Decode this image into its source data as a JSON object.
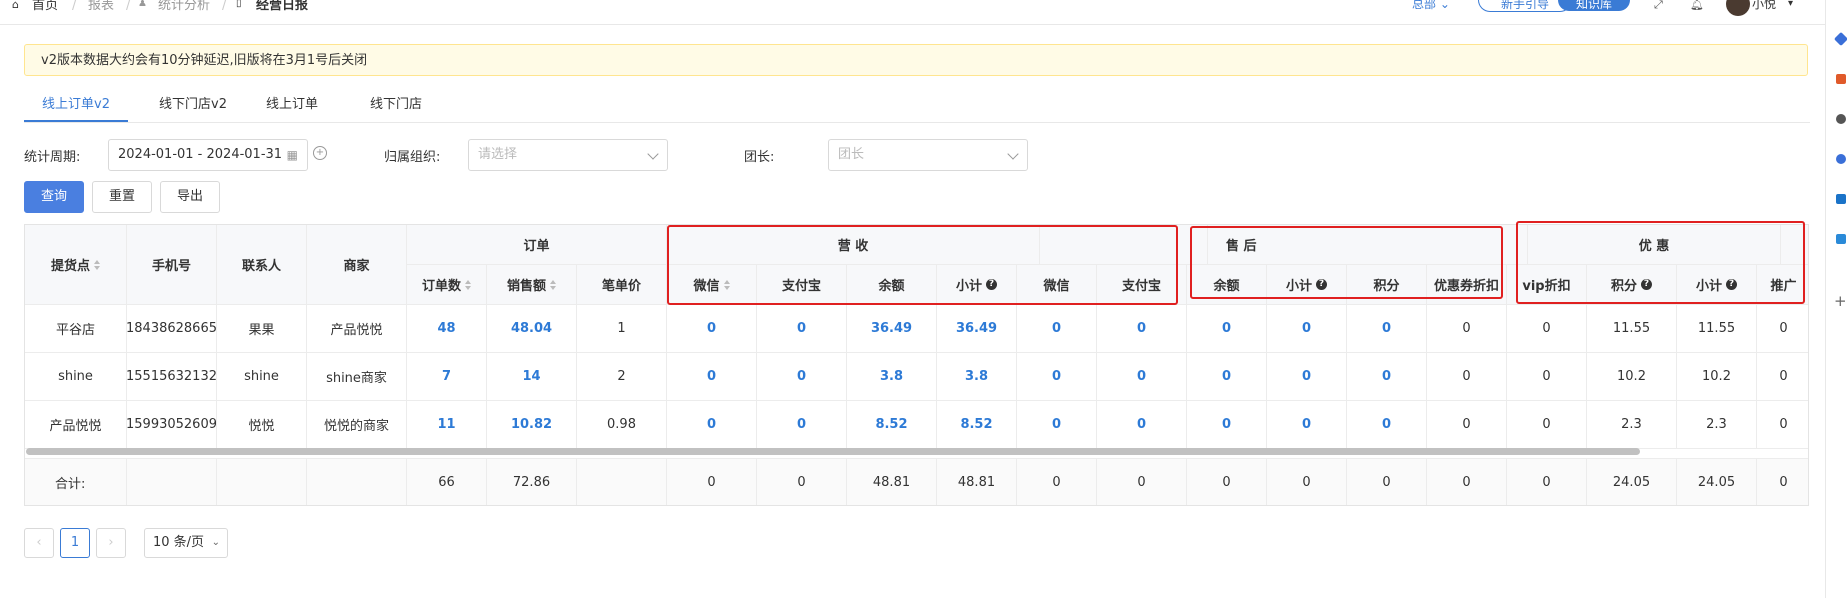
{
  "breadcrumb": [
    "首页",
    "报表",
    "统计分析",
    "经营日报"
  ],
  "header": {
    "org": "总部",
    "guide_button": "新手引导",
    "kb_button": "知识库",
    "username": "小悦"
  },
  "notice": "v2版本数据大约会有10分钟延迟,旧版将在3月1号后关闭",
  "tabs": [
    "线上订单v2",
    "线下门店v2",
    "线上订单",
    "线下门店"
  ],
  "filters": {
    "period_label": "统计周期:",
    "period_value": "2024-01-01 - 2024-01-31",
    "org_label": "归属组织:",
    "org_placeholder": "请选择",
    "leader_label": "团长:",
    "leader_placeholder": "团长"
  },
  "actions": {
    "query": "查询",
    "reset": "重置",
    "export": "导出"
  },
  "table": {
    "fixed_headers": [
      "提货点",
      "手机号",
      "联系人",
      "商家"
    ],
    "groups": {
      "order": "订单",
      "revenue": "营 收",
      "aftersale": "售 后",
      "discount": "优 惠"
    },
    "sub_headers": [
      "订单数",
      "销售额",
      "笔单价",
      "微信",
      "支付宝",
      "余额",
      "小计",
      "微信",
      "支付宝",
      "余额",
      "小计",
      "积分",
      "优惠券折扣",
      "vip折扣",
      "积分",
      "小计",
      "推广"
    ],
    "rows": [
      {
        "store": "平谷店",
        "phone": "18438628665",
        "contact": "果果",
        "merchant": "产品悦悦",
        "values": [
          "48",
          "48.04",
          "1",
          "0",
          "0",
          "36.49",
          "36.49",
          "0",
          "0",
          "0",
          "0",
          "0",
          "0",
          "0",
          "11.55",
          "11.55",
          "0"
        ]
      },
      {
        "store": "shine",
        "phone": "15515632132",
        "contact": "shine",
        "merchant": "shine商家",
        "values": [
          "7",
          "14",
          "2",
          "0",
          "0",
          "3.8",
          "3.8",
          "0",
          "0",
          "0",
          "0",
          "0",
          "0",
          "0",
          "10.2",
          "10.2",
          "0"
        ]
      },
      {
        "store": "产品悦悦",
        "phone": "15993052609",
        "contact": "悦悦",
        "merchant": "悦悦的商家",
        "values": [
          "11",
          "10.82",
          "0.98",
          "0",
          "0",
          "8.52",
          "8.52",
          "0",
          "0",
          "0",
          "0",
          "0",
          "0",
          "0",
          "2.3",
          "2.3",
          "0"
        ]
      }
    ],
    "total_label": "合计:",
    "totals": [
      "66",
      "72.86",
      "0",
      "0",
      "48.81",
      "48.81",
      "0",
      "0",
      "0",
      "0",
      "0",
      "0",
      "0",
      "24.05",
      "24.05",
      "0"
    ]
  },
  "pagination": {
    "current": "1",
    "page_size": "10 条/页"
  }
}
